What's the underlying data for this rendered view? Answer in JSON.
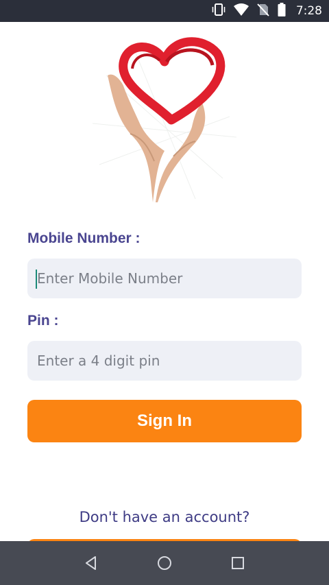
{
  "status_bar": {
    "time": "7:28",
    "icons": [
      "vibrate-icon",
      "wifi-icon",
      "no-sim-icon",
      "battery-icon"
    ]
  },
  "logo": {
    "description_icon": "heart-hands-logo",
    "colors": {
      "heart": "#e0202e",
      "hands": "#e2b394"
    }
  },
  "form": {
    "mobile_label": "Mobile Number :",
    "mobile_placeholder": "Enter Mobile Number",
    "mobile_value": "",
    "pin_label": "Pin :",
    "pin_placeholder": "Enter a 4 digit pin",
    "pin_value": "",
    "sign_in_label": "Sign In"
  },
  "footer": {
    "account_prompt": "Don't have an account?"
  },
  "nav_bar": {
    "buttons": [
      "back-icon",
      "home-icon",
      "recents-icon"
    ]
  },
  "colors": {
    "accent": "#fb8412",
    "label": "#4a4590",
    "input_bg": "#eef0f6",
    "status_bar": "#2b2f3a",
    "nav_bar": "#474a53"
  }
}
